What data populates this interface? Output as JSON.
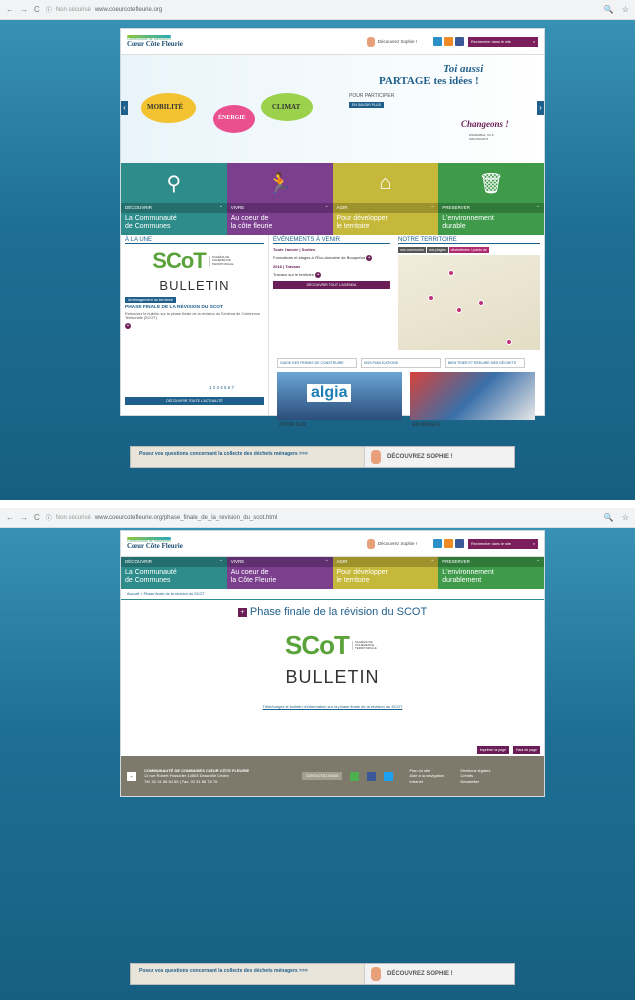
{
  "browser": {
    "secure_label": "Non sécurisé",
    "url1": "www.coeurcotefleurie.org",
    "url2": "www.coeurcotefleurie.org/phase_finale_de_la_revision_du_scot.html"
  },
  "site": {
    "logo_small": "Communauté de communes",
    "logo_name": "Cœur Côte Fleurie",
    "sophie_label": "Découvrez Sophie !",
    "search_placeholder": "Rechercher dans le site"
  },
  "banner": {
    "mobilite": "MOBILITÉ",
    "energie": "ÉNERGIE",
    "climat": "CLIMAT",
    "toi_aussi": "Toi aussi",
    "partage": "PARTAGE tes idées !",
    "pour_participer": "POUR PARTICIPER",
    "en_savoir": "EN SAVOIR PLUS",
    "changeons": "Changeons !",
    "changeons_sub": "ENSEMBLE, ICI & MAINTENANT"
  },
  "nav": [
    {
      "key": "DÉCOUVRIR",
      "label1": "La Communauté",
      "label2": "de Communes",
      "label2b": "de Communes",
      "color": "#2e8d8a"
    },
    {
      "key": "VIVRE",
      "label1": "Au coeur de",
      "label2": "la côte fleurie",
      "label2b": "la Côte Fleurie",
      "color": "#7b3f8e"
    },
    {
      "key": "AGIR",
      "label1": "Pour développer",
      "label2": "le territoire",
      "label2b": "le territoire",
      "color": "#c6b83a"
    },
    {
      "key": "PRESERVER",
      "label1": "L'environnement",
      "label2": "durable",
      "label2b": "durablement",
      "color": "#3f9b4a"
    }
  ],
  "home": {
    "a_la_une": "À LA UNE",
    "evenements": "ÉVÉNEMENTS À VENIR",
    "territoire": "NOTRE TERRITOIRE",
    "scot_letters": "SCoT",
    "scot_text": "SCHÉMA DE COHÉRENCE TERRITORIALE",
    "bulletin": "BULLETIN",
    "tag": "Aménagement du territoire",
    "phase_title": "PHASE FINALE DE LA RÉVISION DU SCOT",
    "phase_desc": "Retrouvez le bulletin sur la phase finale de la révision du Schéma de Cohérence Territoriale (SCOT)",
    "pages": "1 2 3 4 5 6 7",
    "all_news": "DÉCOUVRIR TOUTE L'ACTUALITÉ",
    "ev1_date": "Toute l'année | Sorties",
    "ev1_text": "Formations et stages à l'Éco-domaine de Bouquetot",
    "ev2_date": "2018 | Travaux",
    "ev2_text": "Travaux sur le territoire",
    "agenda": "DÉCOUVRIR TOUT L'AGENDA",
    "tab1": "nos communes",
    "tab2": "nos plages",
    "tab3": "déchetteries / points de",
    "guide": "GUIDE DES PERMIS DE CONSTRUIRE",
    "publications": "NOS PUBLICATIONS",
    "trier": "BIEN TRIER ET RÉDUIRE MES DÉCHETS",
    "algia": "algia",
    "zoom": "ZOOM SUR",
    "images": "EN IMAGES"
  },
  "article": {
    "breadcrumb": "Accueil > Phase finale de la révision du SCOT",
    "title": "Phase finale de la révision du SCOT",
    "download": "Téléchargez le bulletin d'information sur la phase finale de la révision du SCOT",
    "print": "Imprimer la page",
    "top": "Haut de page"
  },
  "footer": {
    "org": "COMMUNAUTÉ DE COMMUNES CŒUR CÔTE FLEURIE",
    "address": "12 rue Robert Fossorier 14803 Deauville Cedex",
    "tel": "Tél. 02 31 88 54 65 | Fax. 02 31 88 78 76",
    "contact": "CONTACTEZ-NOUS",
    "link1": "Plan du site",
    "link2": "Aide à la navigation",
    "link3": "Intranet",
    "link4": "Mentions légales",
    "link5": "Crédits",
    "link6": "Newsletter"
  },
  "cta": {
    "question": "Posez vos questions concernant la collecte des déchets ménagers >>>",
    "decouvrez": "DÉCOUVREZ SOPHIE !"
  }
}
